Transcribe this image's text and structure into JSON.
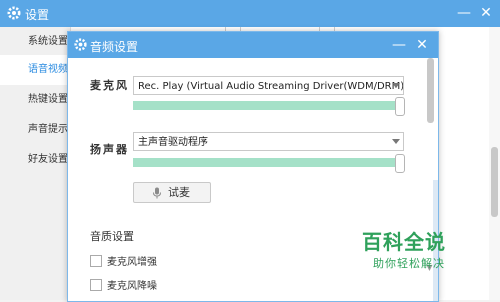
{
  "main_window": {
    "title": "设置",
    "minimize_icon": "minimize-icon",
    "close_icon": "close-icon"
  },
  "sidebar": {
    "items": [
      {
        "label": "系统设置",
        "active": false
      },
      {
        "label": "语音视频",
        "active": true
      },
      {
        "label": "热键设置",
        "active": false
      },
      {
        "label": "声音提示",
        "active": false
      },
      {
        "label": "好友设置",
        "active": false
      }
    ]
  },
  "dialog": {
    "title": "音频设置",
    "microphone": {
      "label": "麦克风",
      "selected": "Rec. Play (Virtual Audio Streaming Driver(WDM/DRM))",
      "level": 1.0
    },
    "speaker": {
      "label": "扬声器",
      "selected": "主声音驱动程序",
      "level": 1.0
    },
    "test_button": {
      "label": "试麦",
      "icon": "microphone-icon"
    },
    "quality_section": {
      "title": "音质设置",
      "options": [
        {
          "label": "麦克风增强",
          "checked": false
        },
        {
          "label": "麦克风降噪",
          "checked": false
        }
      ]
    }
  },
  "watermark": {
    "main": "百科全说",
    "sub": "助你轻松解决"
  },
  "colors": {
    "titlebar": "#5aa7e6",
    "active_sidebar_text": "#2a8be0",
    "slider_fill": "#a5e1c8",
    "watermark": "#2fa15b"
  }
}
